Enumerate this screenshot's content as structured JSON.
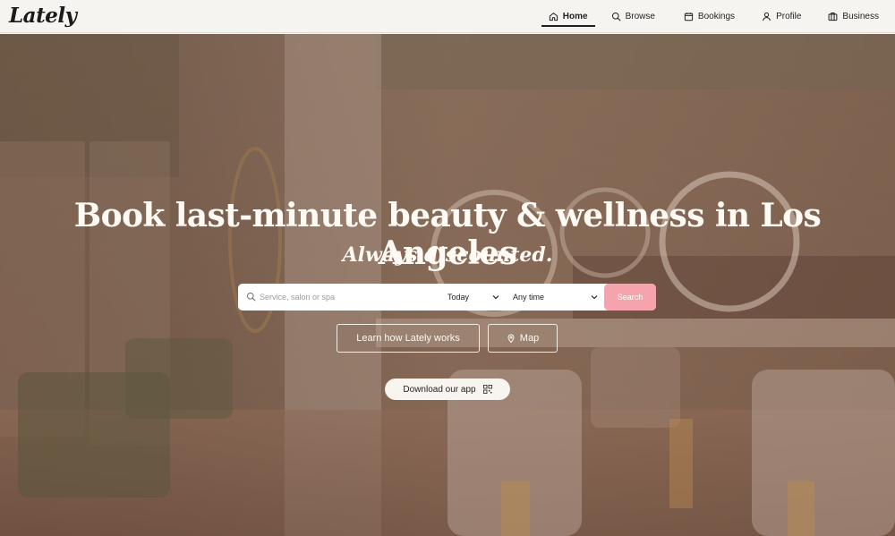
{
  "brand": {
    "logo": "Lately"
  },
  "nav": {
    "home": "Home",
    "browse": "Browse",
    "bookings": "Bookings",
    "profile": "Profile",
    "business": "Business"
  },
  "hero": {
    "title": "Book last-minute beauty & wellness in Los Angeles",
    "subtitle": "Always discounted."
  },
  "search": {
    "placeholder": "Service, salon or spa",
    "date_value": "Today",
    "time_value": "Any time",
    "button_label": "Search"
  },
  "actions": {
    "learn_label": "Learn how Lately works",
    "map_label": "Map",
    "app_label": "Download our app"
  },
  "colors": {
    "accent": "#f5a3ad",
    "header_bg": "#f5f4f1",
    "hero_text": "#fffaf4"
  }
}
